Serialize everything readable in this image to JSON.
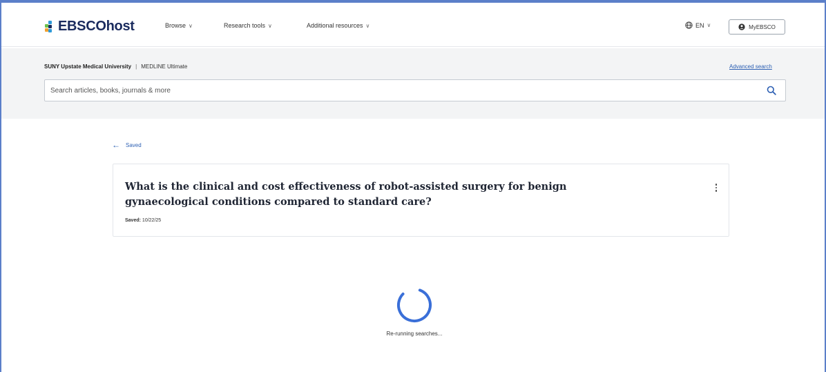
{
  "header": {
    "logo_text": "EBSCOhost",
    "nav": [
      {
        "label": "Browse"
      },
      {
        "label": "Research tools"
      },
      {
        "label": "Additional resources"
      }
    ],
    "language": "EN",
    "account_button": "MyEBSCO"
  },
  "search": {
    "institution": "SUNY Upstate Medical University",
    "separator": "|",
    "database": "MEDLINE Ultimate",
    "advanced_link": "Advanced search",
    "placeholder": "Search articles, books, journals & more"
  },
  "main": {
    "back_label": "Saved",
    "card": {
      "title": "What is the clinical and cost effectiveness of robot-assisted surgery for benign gynaecological conditions compared to standard care?",
      "saved_label": "Saved:",
      "saved_date": "10/22/25"
    },
    "loading_text": "Re-running searches..."
  },
  "colors": {
    "accent_blue": "#2c5fb3",
    "logo_navy": "#1a2b5e",
    "spinner": "#3a6fd8",
    "band_bg": "#f3f4f5"
  },
  "icons": [
    "logo-mark-icon",
    "chevron-down-icon",
    "globe-icon",
    "user-icon",
    "search-icon",
    "arrow-left-icon",
    "kebab-menu-icon",
    "spinner-icon"
  ]
}
